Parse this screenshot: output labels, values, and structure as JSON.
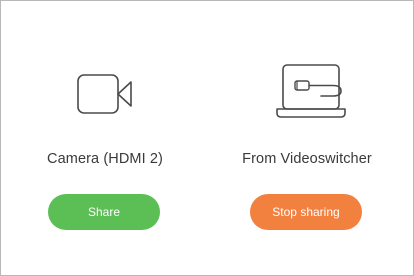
{
  "sources": [
    {
      "label": "Camera (HDMI 2)",
      "icon": "camera-icon",
      "button_label": "Share",
      "button_color": "#5cbf55"
    },
    {
      "label": "From Videoswitcher",
      "icon": "laptop-cable-icon",
      "button_label": "Stop sharing",
      "button_color": "#f2803f"
    }
  ]
}
